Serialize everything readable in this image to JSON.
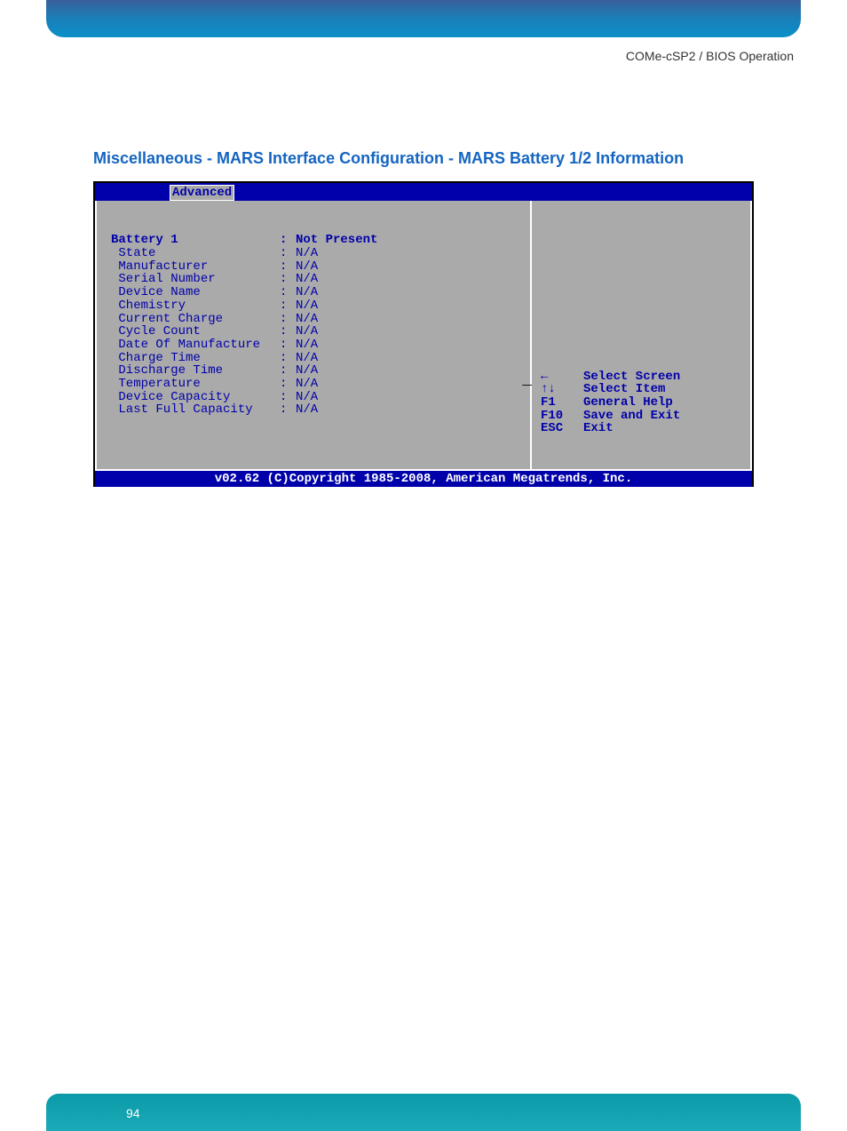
{
  "header": {
    "right_text": "COMe-cSP2 / BIOS Operation"
  },
  "section_title": "Miscellaneous - MARS Interface Configuration - MARS Battery 1/2 Information",
  "bios": {
    "tab": "Advanced",
    "rows": [
      {
        "label": "Battery 1",
        "value": "Not Present",
        "bold": true,
        "indent": false
      },
      {
        "label": "State",
        "value": "N/A",
        "bold": false,
        "indent": true
      },
      {
        "label": "Manufacturer",
        "value": "N/A",
        "bold": false,
        "indent": true
      },
      {
        "label": "Serial Number",
        "value": "N/A",
        "bold": false,
        "indent": true
      },
      {
        "label": "Device Name",
        "value": "N/A",
        "bold": false,
        "indent": true
      },
      {
        "label": "Chemistry",
        "value": "N/A",
        "bold": false,
        "indent": true
      },
      {
        "label": "Current Charge",
        "value": "N/A",
        "bold": false,
        "indent": true
      },
      {
        "label": "Cycle Count",
        "value": "N/A",
        "bold": false,
        "indent": true
      },
      {
        "label": "Date Of Manufacture",
        "value": "N/A",
        "bold": false,
        "indent": true
      },
      {
        "label": "Charge Time",
        "value": "N/A",
        "bold": false,
        "indent": true
      },
      {
        "label": "Discharge Time",
        "value": "N/A",
        "bold": false,
        "indent": true
      },
      {
        "label": "Temperature",
        "value": "N/A",
        "bold": false,
        "indent": true
      },
      {
        "label": "Device Capacity",
        "value": "N/A",
        "bold": false,
        "indent": true
      },
      {
        "label": "Last Full Capacity",
        "value": "N/A",
        "bold": false,
        "indent": true
      }
    ],
    "help": [
      {
        "key": "←",
        "desc": "Select Screen"
      },
      {
        "key": "↑↓",
        "desc": "Select Item"
      },
      {
        "key": "F1",
        "desc": "General Help"
      },
      {
        "key": "F10",
        "desc": "Save and Exit"
      },
      {
        "key": "ESC",
        "desc": "Exit"
      }
    ],
    "footer": "v02.62 (C)Copyright 1985-2008, American Megatrends, Inc."
  },
  "page_number": "94"
}
